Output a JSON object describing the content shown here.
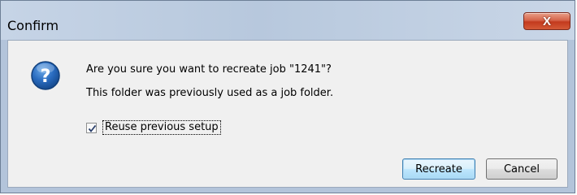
{
  "window": {
    "title": "Confirm",
    "close_glyph": "X"
  },
  "dialog": {
    "icon": "question-icon",
    "message_line1": "Are you sure you want to recreate job \"1241\"?",
    "message_line2": "This folder was previously used as a job folder.",
    "checkbox": {
      "label": "Reuse previous setup",
      "checked": true
    },
    "buttons": {
      "recreate": "Recreate",
      "cancel": "Cancel"
    }
  },
  "colors": {
    "icon_blue": "#1f5fa8",
    "close_red": "#c33a1e"
  }
}
